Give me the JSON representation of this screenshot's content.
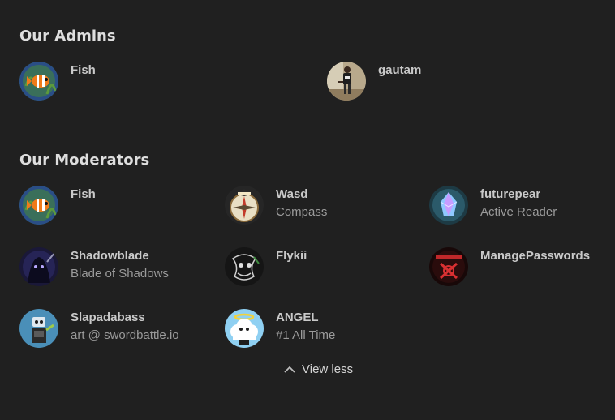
{
  "admins": {
    "heading": "Our Admins",
    "members": [
      {
        "name": "Fish",
        "avatar": "clownfish-avatar"
      },
      {
        "name": "gautam",
        "avatar": "person-photo-avatar"
      }
    ]
  },
  "moderators": {
    "heading": "Our Moderators",
    "members": [
      {
        "name": "Fish",
        "subtitle": "",
        "avatar": "clownfish-avatar"
      },
      {
        "name": "Wasd",
        "subtitle": "Compass",
        "avatar": "compass-avatar"
      },
      {
        "name": "futurepear",
        "subtitle": "Active Reader",
        "avatar": "crystal-pear-avatar"
      },
      {
        "name": "Shadowblade",
        "subtitle": "Blade of Shadows",
        "avatar": "shadow-creature-avatar"
      },
      {
        "name": "Flykii",
        "subtitle": "",
        "avatar": "sketch-art-avatar"
      },
      {
        "name": "ManagePasswords",
        "subtitle": "",
        "avatar": "red-crest-avatar"
      },
      {
        "name": "Slapadabass",
        "subtitle": "art @ swordbattle.io",
        "avatar": "robot-avatar"
      },
      {
        "name": "ANGEL",
        "subtitle": "#1 All Time",
        "avatar": "angel-cloud-avatar"
      }
    ]
  },
  "footer": {
    "view_less_label": "View less",
    "view_less_icon": "chevron-up-icon"
  },
  "colors": {
    "background": "#202020",
    "heading": "#dedede",
    "name": "#c9c9c9",
    "subtitle": "#9b9b9b"
  }
}
